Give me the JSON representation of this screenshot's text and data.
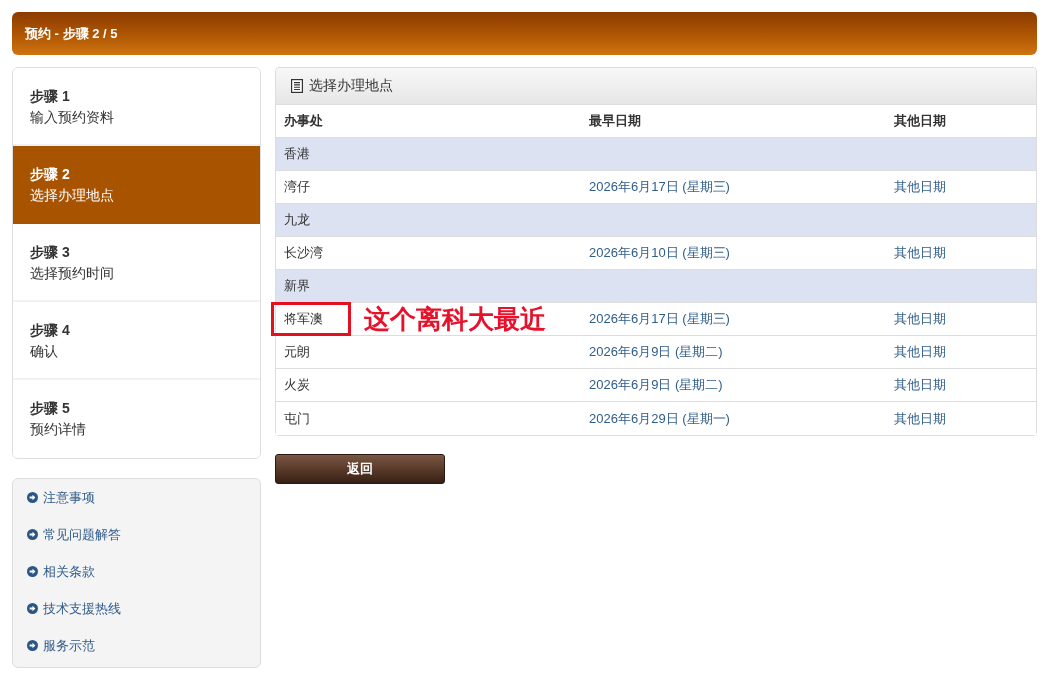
{
  "title_bar": {
    "title": "预约 - 步骤 2 / 5"
  },
  "steps": [
    {
      "label": "步骤 1",
      "description": "输入预约资料",
      "selected": false
    },
    {
      "label": "步骤 2",
      "description": "选择办理地点",
      "selected": true
    },
    {
      "label": "步骤 3",
      "description": "选择预约时间",
      "selected": false
    },
    {
      "label": "步骤 4",
      "description": "确认",
      "selected": false
    },
    {
      "label": "步骤 5",
      "description": "预约详情",
      "selected": false
    }
  ],
  "links": [
    {
      "label": "注意事项"
    },
    {
      "label": "常见问题解答"
    },
    {
      "label": "相关条款"
    },
    {
      "label": "技术支援热线"
    },
    {
      "label": "服务示范"
    }
  ],
  "location_panel": {
    "title": "选择办理地点",
    "columns": [
      "办事处",
      "最早日期",
      "其他日期"
    ],
    "rows": [
      {
        "kind": "region",
        "name": "香港"
      },
      {
        "kind": "office",
        "name": "湾仔",
        "earliest_date": "2026年6月17日 (星期三)",
        "other_dates": "其他日期",
        "highlighted": false
      },
      {
        "kind": "region",
        "name": "九龙"
      },
      {
        "kind": "office",
        "name": "长沙湾",
        "earliest_date": "2026年6月10日 (星期三)",
        "other_dates": "其他日期",
        "highlighted": false
      },
      {
        "kind": "region",
        "name": "新界"
      },
      {
        "kind": "office",
        "name": "将军澳",
        "earliest_date": "2026年6月17日 (星期三)",
        "other_dates": "其他日期",
        "highlighted": true,
        "note": "这个离科大最近"
      },
      {
        "kind": "office",
        "name": "元朗",
        "earliest_date": "2026年6月9日 (星期二)",
        "other_dates": "其他日期",
        "highlighted": false
      },
      {
        "kind": "office",
        "name": "火炭",
        "earliest_date": "2026年6月9日 (星期二)",
        "other_dates": "其他日期",
        "highlighted": false
      },
      {
        "kind": "office",
        "name": "屯门",
        "earliest_date": "2026年6月29日 (星期一)",
        "other_dates": "其他日期",
        "highlighted": false
      }
    ]
  },
  "back_button": {
    "label": "返回"
  }
}
